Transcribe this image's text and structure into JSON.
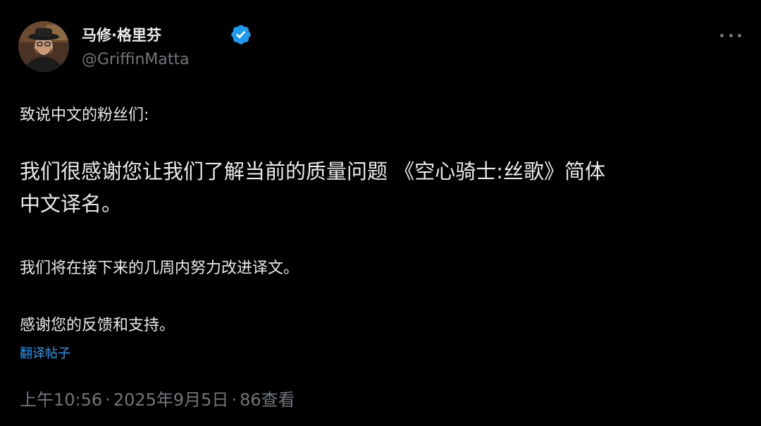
{
  "author": {
    "display_name": "马修·格里芬",
    "handle": "@GriffinMatta",
    "verified": true
  },
  "tweet": {
    "greeting": "致说中文的粉丝们:",
    "paragraph1_line1": "我们很感谢您让我们了解当前的质量问题 《空心骑士:丝歌》简体",
    "paragraph1_line2": "中文译名。",
    "paragraph2": "我们将在接下来的几周内努力改进译文。",
    "paragraph3": "感谢您的反馈和支持。"
  },
  "actions": {
    "translate_label": "翻译帖子",
    "more_icon": "more-horizontal-icon"
  },
  "meta": {
    "time": "上午10:56",
    "separator": "·",
    "date": "2025年9月5日",
    "views": "86",
    "views_label": "查看"
  },
  "colors": {
    "background": "#000000",
    "text_primary": "#e7e9ea",
    "text_secondary": "#71767b",
    "link": "#1d9bf0",
    "verified_badge": "#1d9bf0"
  }
}
